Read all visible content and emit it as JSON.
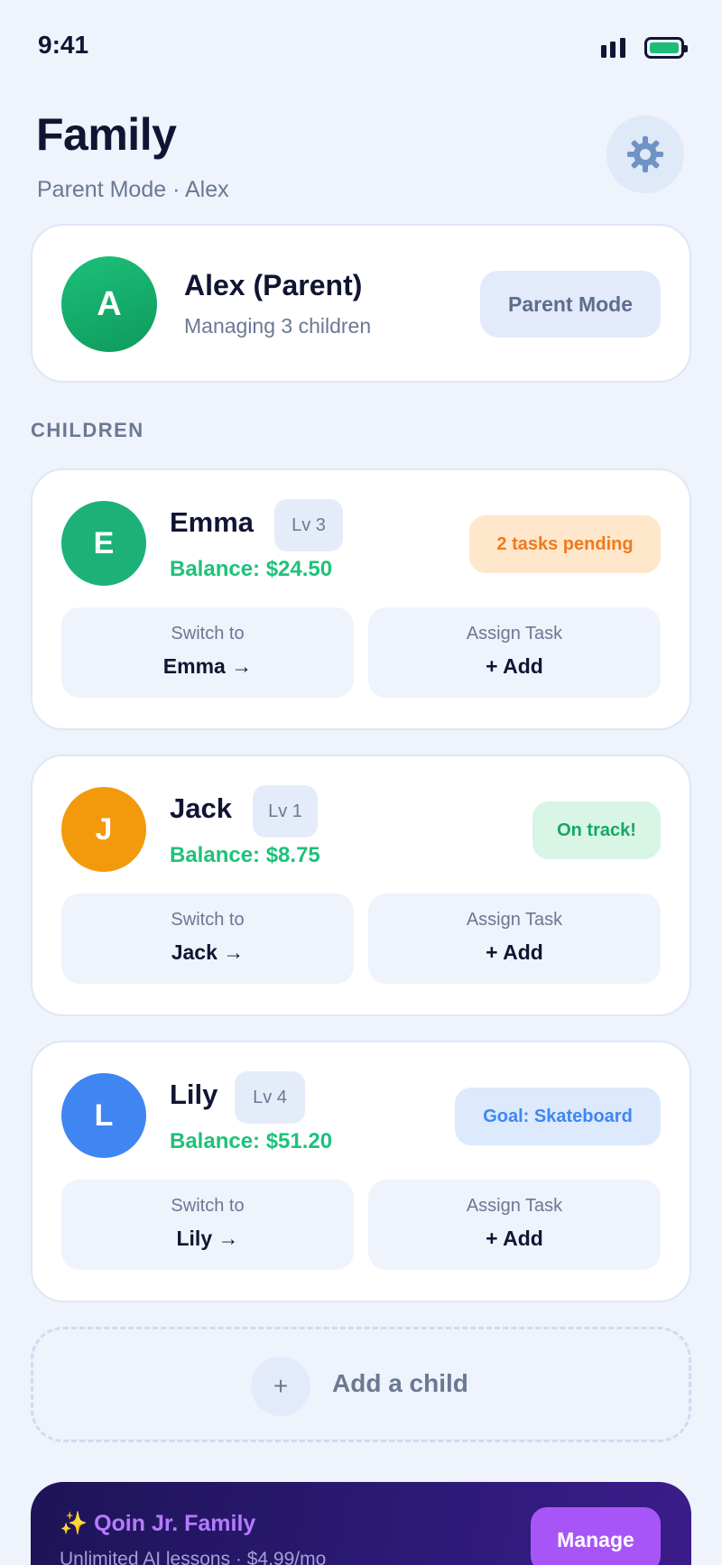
{
  "status_bar": {
    "time": "9:41",
    "signal_icon": "signal-bars-icon",
    "battery_icon": "battery-icon",
    "battery_color": "#1fba7a"
  },
  "header": {
    "title": "Family",
    "subtitle": "Parent Mode · Alex",
    "settings_icon": "⚙️"
  },
  "parent": {
    "initial": "A",
    "name": "Alex (Parent)",
    "subtitle": "Managing 3 children",
    "mode_label": "Parent Mode",
    "avatar_color": "#16a96a"
  },
  "children_section": {
    "label": "CHILDREN"
  },
  "children": [
    {
      "initial": "E",
      "name": "Emma",
      "level": "Lv 3",
      "balance": "Balance: $24.50",
      "status": "2 tasks pending",
      "avatar_color": "#1cb277",
      "status_bg": "#ffe7cc",
      "status_color": "#f07a1a",
      "switch_caption": "Switch to",
      "switch_label": "Emma →",
      "assign_caption": "Assign Task",
      "assign_label": "+ Add"
    },
    {
      "initial": "J",
      "name": "Jack",
      "level": "Lv 1",
      "balance": "Balance: $8.75",
      "status": "On track!",
      "avatar_color": "#f29a0c",
      "status_bg": "#d8f5e6",
      "status_color": "#15a865",
      "switch_caption": "Switch to",
      "switch_label": "Jack →",
      "assign_caption": "Assign Task",
      "assign_label": "+ Add"
    },
    {
      "initial": "L",
      "name": "Lily",
      "level": "Lv 4",
      "balance": "Balance: $51.20",
      "status": "Goal: Skateboard",
      "avatar_color": "#3f86f2",
      "status_bg": "#dde9fc",
      "status_color": "#3f86f2",
      "switch_caption": "Switch to",
      "switch_label": "Lily →",
      "assign_caption": "Assign Task",
      "assign_label": "+ Add"
    }
  ],
  "add_child": {
    "icon": "+",
    "label": "Add a child"
  },
  "promo": {
    "title": "✨ Qoin Jr. Family",
    "subtitle": "Unlimited AI lessons · $4.99/mo",
    "button_label": "Manage",
    "accent_color": "#a855f7"
  }
}
